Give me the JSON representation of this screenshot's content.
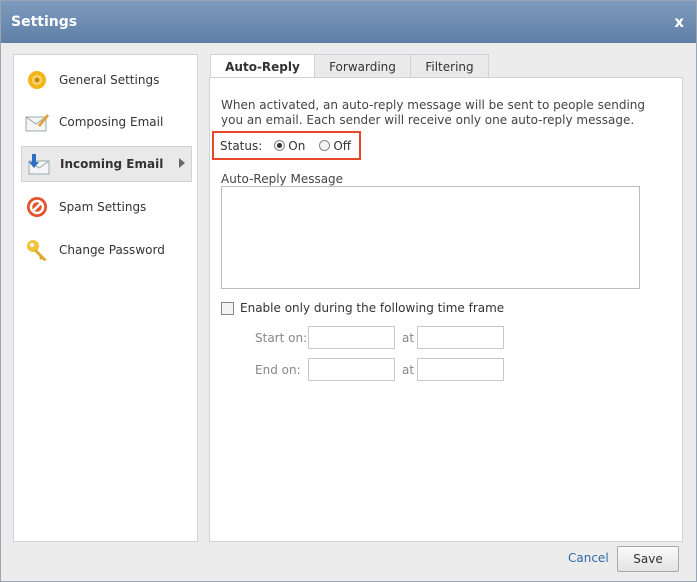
{
  "window": {
    "title": "Settings",
    "close_label": "x"
  },
  "sidebar": {
    "items": [
      {
        "label": "General Settings",
        "icon": "gear-icon"
      },
      {
        "label": "Composing Email",
        "icon": "compose-icon"
      },
      {
        "label": "Incoming Email",
        "icon": "incoming-icon",
        "selected": true
      },
      {
        "label": "Spam Settings",
        "icon": "block-icon"
      },
      {
        "label": "Change Password",
        "icon": "key-icon"
      }
    ]
  },
  "tabs": [
    {
      "label": "Auto-Reply",
      "active": true
    },
    {
      "label": "Forwarding"
    },
    {
      "label": "Filtering"
    }
  ],
  "autoreply": {
    "description": "When activated, an auto-reply message will be sent to people sending you an email. Each sender will receive only one auto-reply message.",
    "status_label": "Status:",
    "on_label": "On",
    "off_label": "Off",
    "status_value": "On",
    "message_label": "Auto-Reply Message",
    "message_value": "",
    "timeframe_label": "Enable only during the following time frame",
    "timeframe_checked": false,
    "start_label": "Start on:",
    "end_label": "End on:",
    "at_label": "at",
    "start_date": "",
    "start_time": "",
    "end_date": "",
    "end_time": ""
  },
  "footer": {
    "cancel_label": "Cancel",
    "save_label": "Save"
  },
  "colors": {
    "titlebar": "#6d8db3",
    "highlight": "#e8472a",
    "link": "#2f6aa8"
  }
}
